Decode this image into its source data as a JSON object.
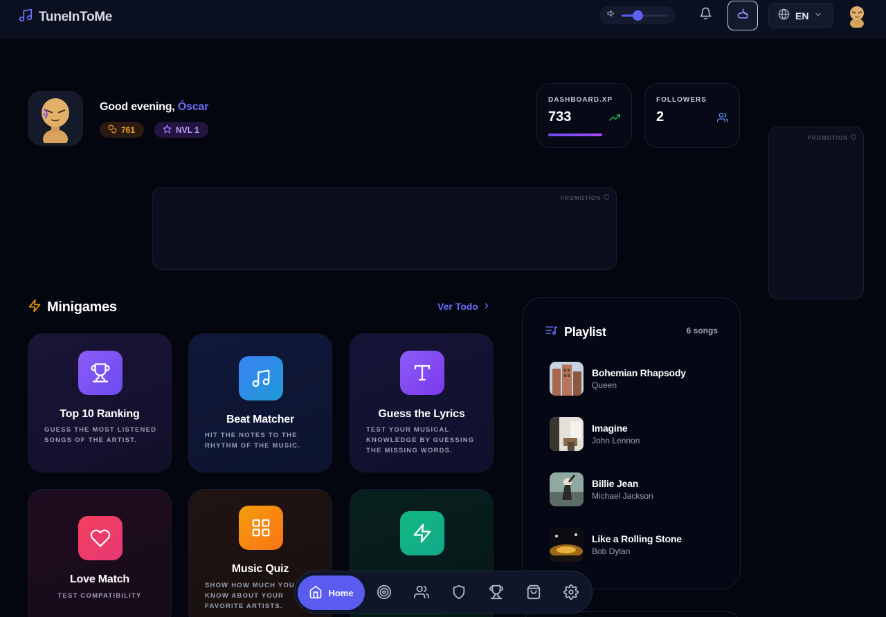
{
  "app": {
    "name": "TuneInToMe"
  },
  "header": {
    "volume": 0.35,
    "language": "EN"
  },
  "profile": {
    "greeting": "Good evening, ",
    "name": "Óscar",
    "coins": "761",
    "level": "NVL 1"
  },
  "stats": {
    "xp_label": "DASHBOARD.XP",
    "xp_value": "733",
    "followers_label": "FOLLOWERS",
    "followers_value": "2"
  },
  "promotions": {
    "label": "PROMOTION"
  },
  "minigames": {
    "title": "Minigames",
    "see_all": "Ver Todo",
    "cards": [
      {
        "title": "Top 10 Ranking",
        "desc": "GUESS THE MOST LISTENED SONGS OF THE ARTIST.",
        "icon": "trophy-icon"
      },
      {
        "title": "Beat Matcher",
        "desc": "HIT THE NOTES TO THE RHYTHM OF THE MUSIC.",
        "icon": "music-note-icon"
      },
      {
        "title": "Guess the Lyrics",
        "desc": "TEST YOUR MUSICAL KNOWLEDGE BY GUESSING THE MISSING WORDS.",
        "icon": "text-icon"
      },
      {
        "title": "Love Match",
        "desc": "TEST COMPATIBILITY",
        "icon": "heart-icon"
      },
      {
        "title": "Music Quiz",
        "desc": "SHOW HOW MUCH YOU KNOW ABOUT YOUR FAVORITE ARTISTS.",
        "icon": "grid-icon"
      },
      {
        "title": "",
        "desc": "",
        "icon": "lightning-icon"
      }
    ]
  },
  "playlist": {
    "title": "Playlist",
    "count": "6 songs",
    "songs": [
      {
        "title": "Bohemian Rhapsody",
        "artist": "Queen"
      },
      {
        "title": "Imagine",
        "artist": "John Lennon"
      },
      {
        "title": "Billie Jean",
        "artist": "Michael Jackson"
      },
      {
        "title": "Like a Rolling Stone",
        "artist": "Bob Dylan"
      }
    ]
  },
  "nav": {
    "home": "Home",
    "items": [
      "target-icon",
      "users-icon",
      "shield-icon",
      "trophy-icon",
      "shopping-bag-icon",
      "settings-icon"
    ]
  },
  "colors": {
    "accent": "#5a5cf0",
    "background": "#03050f",
    "coins": "#f5a524",
    "level": "#c4a6ff"
  }
}
